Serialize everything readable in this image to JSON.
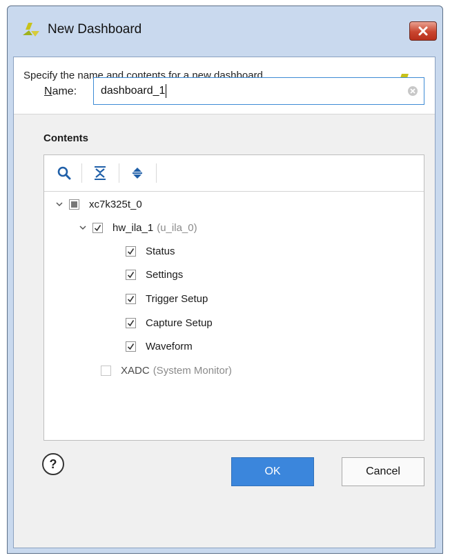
{
  "window": {
    "title": "New Dashboard",
    "close_label": "×"
  },
  "header": {
    "description": "Specify the name and contents for a new dashboard."
  },
  "name_field": {
    "label_mnemonic": "N",
    "label_rest": "ame:",
    "value": "dashboard_1"
  },
  "contents": {
    "label": "Contents",
    "toolbar": [
      "search-icon",
      "collapse-all-icon",
      "expand-all-icon"
    ],
    "tree": {
      "device": {
        "label": "xc7k325t_0",
        "state": "partial",
        "expanded": true
      },
      "ila": {
        "label": "hw_ila_1",
        "sublabel": "(u_ila_0)",
        "state": "checked",
        "expanded": true
      },
      "ila_children": [
        {
          "label": "Status",
          "state": "checked"
        },
        {
          "label": "Settings",
          "state": "checked"
        },
        {
          "label": "Trigger Setup",
          "state": "checked"
        },
        {
          "label": "Capture Setup",
          "state": "checked"
        },
        {
          "label": "Waveform",
          "state": "checked"
        }
      ],
      "xadc": {
        "label": "XADC",
        "sublabel": "(System Monitor)",
        "state": "disabled"
      }
    }
  },
  "footer": {
    "help_label": "?",
    "ok_label": "OK",
    "cancel_label": "Cancel"
  },
  "colors": {
    "accent": "#3b86dc",
    "logo_yellow": "#a8b51a",
    "close_red": "#c9452f"
  }
}
